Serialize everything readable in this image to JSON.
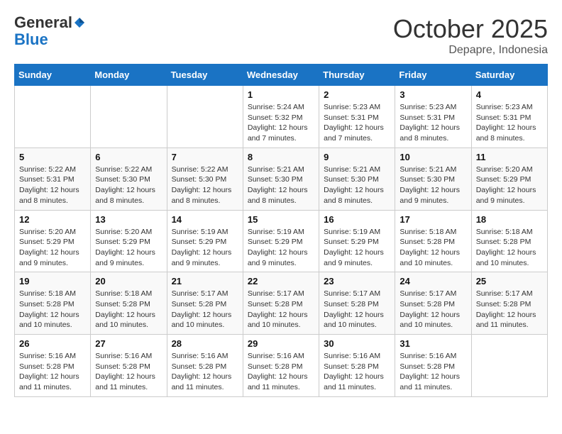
{
  "header": {
    "logo_line1": "General",
    "logo_line2": "Blue",
    "month": "October 2025",
    "location": "Depapre, Indonesia"
  },
  "weekdays": [
    "Sunday",
    "Monday",
    "Tuesday",
    "Wednesday",
    "Thursday",
    "Friday",
    "Saturday"
  ],
  "weeks": [
    [
      {
        "day": "",
        "info": ""
      },
      {
        "day": "",
        "info": ""
      },
      {
        "day": "",
        "info": ""
      },
      {
        "day": "1",
        "info": "Sunrise: 5:24 AM\nSunset: 5:32 PM\nDaylight: 12 hours\nand 7 minutes."
      },
      {
        "day": "2",
        "info": "Sunrise: 5:23 AM\nSunset: 5:31 PM\nDaylight: 12 hours\nand 7 minutes."
      },
      {
        "day": "3",
        "info": "Sunrise: 5:23 AM\nSunset: 5:31 PM\nDaylight: 12 hours\nand 8 minutes."
      },
      {
        "day": "4",
        "info": "Sunrise: 5:23 AM\nSunset: 5:31 PM\nDaylight: 12 hours\nand 8 minutes."
      }
    ],
    [
      {
        "day": "5",
        "info": "Sunrise: 5:22 AM\nSunset: 5:31 PM\nDaylight: 12 hours\nand 8 minutes."
      },
      {
        "day": "6",
        "info": "Sunrise: 5:22 AM\nSunset: 5:30 PM\nDaylight: 12 hours\nand 8 minutes."
      },
      {
        "day": "7",
        "info": "Sunrise: 5:22 AM\nSunset: 5:30 PM\nDaylight: 12 hours\nand 8 minutes."
      },
      {
        "day": "8",
        "info": "Sunrise: 5:21 AM\nSunset: 5:30 PM\nDaylight: 12 hours\nand 8 minutes."
      },
      {
        "day": "9",
        "info": "Sunrise: 5:21 AM\nSunset: 5:30 PM\nDaylight: 12 hours\nand 8 minutes."
      },
      {
        "day": "10",
        "info": "Sunrise: 5:21 AM\nSunset: 5:30 PM\nDaylight: 12 hours\nand 9 minutes."
      },
      {
        "day": "11",
        "info": "Sunrise: 5:20 AM\nSunset: 5:29 PM\nDaylight: 12 hours\nand 9 minutes."
      }
    ],
    [
      {
        "day": "12",
        "info": "Sunrise: 5:20 AM\nSunset: 5:29 PM\nDaylight: 12 hours\nand 9 minutes."
      },
      {
        "day": "13",
        "info": "Sunrise: 5:20 AM\nSunset: 5:29 PM\nDaylight: 12 hours\nand 9 minutes."
      },
      {
        "day": "14",
        "info": "Sunrise: 5:19 AM\nSunset: 5:29 PM\nDaylight: 12 hours\nand 9 minutes."
      },
      {
        "day": "15",
        "info": "Sunrise: 5:19 AM\nSunset: 5:29 PM\nDaylight: 12 hours\nand 9 minutes."
      },
      {
        "day": "16",
        "info": "Sunrise: 5:19 AM\nSunset: 5:29 PM\nDaylight: 12 hours\nand 9 minutes."
      },
      {
        "day": "17",
        "info": "Sunrise: 5:18 AM\nSunset: 5:28 PM\nDaylight: 12 hours\nand 10 minutes."
      },
      {
        "day": "18",
        "info": "Sunrise: 5:18 AM\nSunset: 5:28 PM\nDaylight: 12 hours\nand 10 minutes."
      }
    ],
    [
      {
        "day": "19",
        "info": "Sunrise: 5:18 AM\nSunset: 5:28 PM\nDaylight: 12 hours\nand 10 minutes."
      },
      {
        "day": "20",
        "info": "Sunrise: 5:18 AM\nSunset: 5:28 PM\nDaylight: 12 hours\nand 10 minutes."
      },
      {
        "day": "21",
        "info": "Sunrise: 5:17 AM\nSunset: 5:28 PM\nDaylight: 12 hours\nand 10 minutes."
      },
      {
        "day": "22",
        "info": "Sunrise: 5:17 AM\nSunset: 5:28 PM\nDaylight: 12 hours\nand 10 minutes."
      },
      {
        "day": "23",
        "info": "Sunrise: 5:17 AM\nSunset: 5:28 PM\nDaylight: 12 hours\nand 10 minutes."
      },
      {
        "day": "24",
        "info": "Sunrise: 5:17 AM\nSunset: 5:28 PM\nDaylight: 12 hours\nand 10 minutes."
      },
      {
        "day": "25",
        "info": "Sunrise: 5:17 AM\nSunset: 5:28 PM\nDaylight: 12 hours\nand 11 minutes."
      }
    ],
    [
      {
        "day": "26",
        "info": "Sunrise: 5:16 AM\nSunset: 5:28 PM\nDaylight: 12 hours\nand 11 minutes."
      },
      {
        "day": "27",
        "info": "Sunrise: 5:16 AM\nSunset: 5:28 PM\nDaylight: 12 hours\nand 11 minutes."
      },
      {
        "day": "28",
        "info": "Sunrise: 5:16 AM\nSunset: 5:28 PM\nDaylight: 12 hours\nand 11 minutes."
      },
      {
        "day": "29",
        "info": "Sunrise: 5:16 AM\nSunset: 5:28 PM\nDaylight: 12 hours\nand 11 minutes."
      },
      {
        "day": "30",
        "info": "Sunrise: 5:16 AM\nSunset: 5:28 PM\nDaylight: 12 hours\nand 11 minutes."
      },
      {
        "day": "31",
        "info": "Sunrise: 5:16 AM\nSunset: 5:28 PM\nDaylight: 12 hours\nand 11 minutes."
      },
      {
        "day": "",
        "info": ""
      }
    ]
  ]
}
